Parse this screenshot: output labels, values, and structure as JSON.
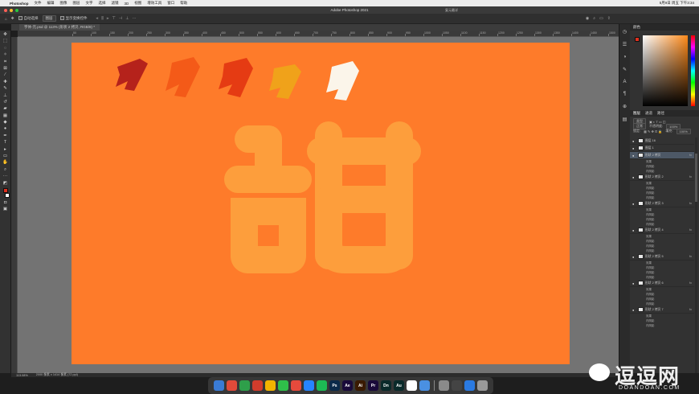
{
  "menubar": {
    "app_name": "Photoshop",
    "items": [
      "文件",
      "编辑",
      "图像",
      "图层",
      "文字",
      "选择",
      "滤镜",
      "3D",
      "视图",
      "增效工具",
      "窗口",
      "帮助"
    ],
    "right_status": "5月9日 周五 下午3:34"
  },
  "window": {
    "title": "Adobe Photoshop 2021",
    "share_label": "复元最详"
  },
  "options_bar": {
    "auto_select_label": "自动选择",
    "auto_select_target": "图层",
    "transform_label": "显示变换控件"
  },
  "document": {
    "tab_title": "字体-元.psd @ 113% (形状 2 拷贝, RGB/8) *"
  },
  "ruler_ticks": [
    "50",
    "100",
    "150",
    "200",
    "250",
    "300",
    "350",
    "400",
    "450",
    "500",
    "550",
    "600",
    "650",
    "700",
    "750",
    "800",
    "850",
    "900",
    "950",
    "1000",
    "1050",
    "1100",
    "1150",
    "1200",
    "1250",
    "1300",
    "1350",
    "1400",
    "1450",
    "1500",
    "1550",
    "1600"
  ],
  "canvas": {
    "background": "#fe7b2a",
    "glyph_color": "#fd9e3c",
    "glyph_char": "甜",
    "swatches": [
      "#b5221b",
      "#f45a18",
      "#e53b13",
      "#f0a21a",
      "#fbf5ea"
    ]
  },
  "status": {
    "zoom": "113.08%",
    "doc_size": "2000 像素 x 1414 像素 (72 ppi)"
  },
  "panels": {
    "color_tab": "颜色",
    "layer_tabs": [
      "图层",
      "通道",
      "路径"
    ],
    "kind_label": "类型",
    "blend_mode": "正常",
    "opacity_label": "不透明度:",
    "opacity_value": "100%",
    "lock_label": "锁定:",
    "fill_label": "填充:",
    "fill_value": "100%"
  },
  "layers": [
    {
      "name": "图层 16",
      "selected": false,
      "effects": []
    },
    {
      "name": "图层 1",
      "selected": false,
      "effects": []
    },
    {
      "name": "形状 2 拷贝",
      "selected": true,
      "effects": [
        "效果",
        "内阴影",
        "内阴影"
      ]
    },
    {
      "name": "形状 2 拷贝 2",
      "selected": false,
      "effects": [
        "效果",
        "内阴影",
        "内阴影",
        "内阴影"
      ]
    },
    {
      "name": "形状 2 拷贝 3",
      "selected": false,
      "effects": [
        "效果",
        "内阴影",
        "内阴影",
        "内阴影"
      ]
    },
    {
      "name": "形状 2 拷贝 4",
      "selected": false,
      "effects": [
        "效果",
        "内阴影",
        "内阴影",
        "内阴影"
      ]
    },
    {
      "name": "形状 2 拷贝 5",
      "selected": false,
      "effects": [
        "效果",
        "内阴影",
        "内阴影",
        "内阴影"
      ]
    },
    {
      "name": "形状 2 拷贝 6",
      "selected": false,
      "effects": [
        "效果",
        "内阴影",
        "内阴影",
        "内阴影"
      ]
    },
    {
      "name": "形状 2 拷贝 7",
      "selected": false,
      "effects": [
        "效果",
        "内阴影",
        "内阴影"
      ]
    }
  ],
  "dock": {
    "apps": [
      {
        "label": "",
        "color": "#3a7bd5",
        "icon": "finder-icon"
      },
      {
        "label": "",
        "color": "#e04a3a",
        "icon": "launchpad-icon"
      },
      {
        "label": "",
        "color": "#2e9f4a",
        "icon": "messages-icon"
      },
      {
        "label": "",
        "color": "#d23c2c",
        "icon": "tools-icon"
      },
      {
        "label": "",
        "color": "#f2b400",
        "icon": "chrome-icon"
      },
      {
        "label": "",
        "color": "#2fbf4a",
        "icon": "wechat-icon"
      },
      {
        "label": "",
        "color": "#e64a3c",
        "icon": "netease-icon"
      },
      {
        "label": "",
        "color": "#2684ff",
        "icon": "qq-icon"
      },
      {
        "label": "",
        "color": "#1db954",
        "icon": "spotify-icon"
      },
      {
        "label": "Ps",
        "color": "#0b2a4a",
        "icon": "photoshop-icon"
      },
      {
        "label": "Ae",
        "color": "#1a0a3a",
        "icon": "aftereffects-icon"
      },
      {
        "label": "Ai",
        "color": "#3a1a00",
        "icon": "illustrator-icon"
      },
      {
        "label": "Pr",
        "color": "#1a0a3a",
        "icon": "premiere-icon"
      },
      {
        "label": "Dn",
        "color": "#0a2a2a",
        "icon": "dimension-icon"
      },
      {
        "label": "Au",
        "color": "#0a2a2a",
        "icon": "audition-icon"
      },
      {
        "label": "",
        "color": "#ffffff",
        "icon": "notes-icon"
      },
      {
        "label": "",
        "color": "#4a90e2",
        "icon": "word-icon"
      },
      {
        "label": "",
        "color": "#8a8a8a",
        "icon": "settings-icon"
      },
      {
        "label": "",
        "color": "#444444",
        "icon": "screenshot-icon"
      },
      {
        "label": "",
        "color": "#2a7ae2",
        "icon": "folder-icon"
      },
      {
        "label": "",
        "color": "#9a9a9a",
        "icon": "trash-icon"
      }
    ]
  },
  "watermark": {
    "title": "逗逗网",
    "subtitle": "DOANDOAN.COM"
  }
}
